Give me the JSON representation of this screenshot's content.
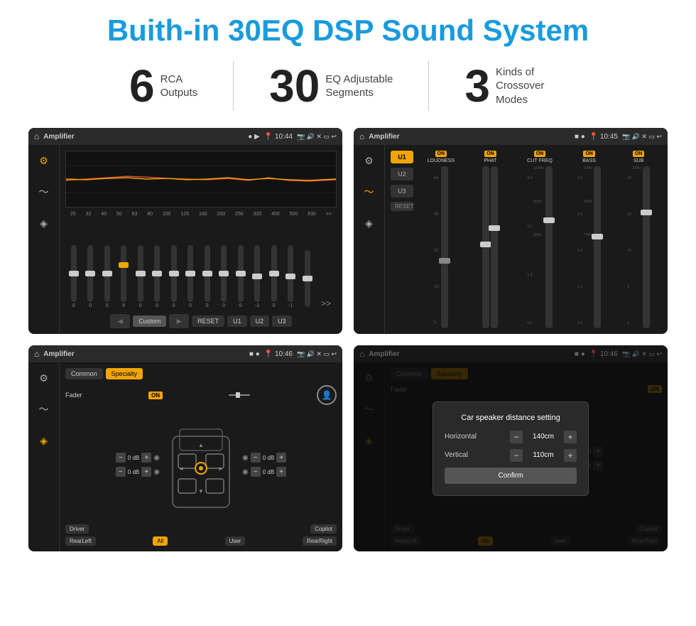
{
  "title": "Buith-in 30EQ DSP Sound System",
  "stats": [
    {
      "number": "6",
      "label": "RCA\nOutputs"
    },
    {
      "number": "30",
      "label": "EQ Adjustable\nSegments"
    },
    {
      "number": "3",
      "label": "Kinds of\nCrossover Modes"
    }
  ],
  "screens": [
    {
      "id": "eq-screen",
      "topbar": {
        "app": "Amplifier",
        "time": "10:44"
      },
      "type": "eq"
    },
    {
      "id": "dsp-screen",
      "topbar": {
        "app": "Amplifier",
        "time": "10:45"
      },
      "type": "dsp"
    },
    {
      "id": "fader-screen",
      "topbar": {
        "app": "Amplifier",
        "time": "10:46"
      },
      "type": "fader"
    },
    {
      "id": "dialog-screen",
      "topbar": {
        "app": "Amplifier",
        "time": "10:46"
      },
      "type": "dialog",
      "dialog": {
        "title": "Car speaker distance setting",
        "horizontal_label": "Horizontal",
        "horizontal_value": "140cm",
        "vertical_label": "Vertical",
        "vertical_value": "110cm",
        "confirm": "Confirm"
      }
    }
  ],
  "eq": {
    "freqs": [
      "25",
      "32",
      "40",
      "50",
      "63",
      "80",
      "100",
      "125",
      "160",
      "200",
      "250",
      "320",
      "400",
      "500",
      "630"
    ],
    "values": [
      "0",
      "0",
      "0",
      "5",
      "0",
      "0",
      "0",
      "0",
      "0",
      "0",
      "0",
      "-1",
      "0",
      "-1",
      ""
    ],
    "buttons": [
      "◄",
      "Custom",
      "►",
      "RESET",
      "U1",
      "U2",
      "U3"
    ]
  },
  "dsp": {
    "presets": [
      "U1",
      "U2",
      "U3"
    ],
    "channels": [
      {
        "on": true,
        "name": "LOUDNESS"
      },
      {
        "on": true,
        "name": "PHAT"
      },
      {
        "on": true,
        "name": "CUT FREQ"
      },
      {
        "on": true,
        "name": "BASS"
      },
      {
        "on": true,
        "name": "SUB"
      }
    ]
  },
  "fader": {
    "tabs": [
      "Common",
      "Specialty"
    ],
    "fader_label": "Fader",
    "on": "ON",
    "buttons": [
      "Driver",
      "Copilot",
      "RearLeft",
      "All",
      "User",
      "RearRight"
    ],
    "vol_labels": [
      "0 dB",
      "0 dB",
      "0 dB",
      "0 dB"
    ]
  },
  "dialog": {
    "title": "Car speaker distance setting",
    "horizontal": "Horizontal",
    "horizontal_val": "140cm",
    "vertical": "Vertical",
    "vertical_val": "110cm",
    "confirm": "Confirm"
  }
}
